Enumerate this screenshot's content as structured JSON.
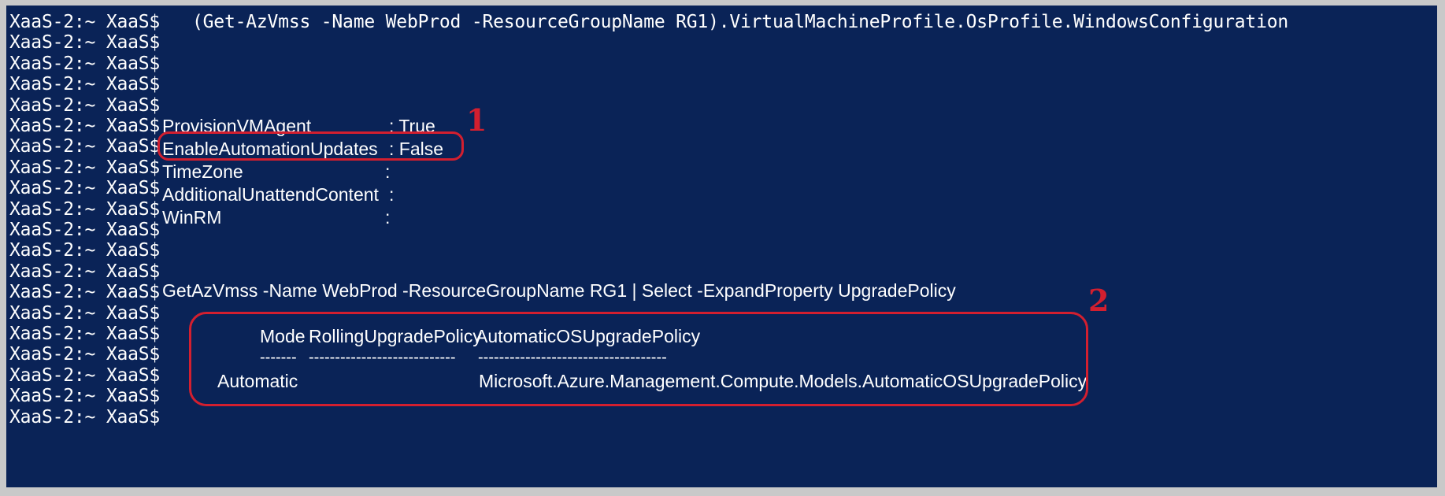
{
  "terminal": {
    "prompt": "XaaS-2:~ XaaS$",
    "command1": "(Get-AzVmss -Name WebProd -ResourceGroupName RG1).VirtualMachineProfile.OsProfile.WindowsConfiguration",
    "properties": [
      {
        "name": "ProvisionVMAgent",
        "value": ": True"
      },
      {
        "name": "EnableAutomationUpdates",
        "value": ": False"
      },
      {
        "name": "TimeZone",
        "value": ":"
      },
      {
        "name": "AdditionalUnattendContent",
        "value": ":"
      },
      {
        "name": "WinRM",
        "value": ":"
      }
    ],
    "command2": "GetAzVmss -Name WebProd -ResourceGroupName RG1 | Select -ExpandProperty UpgradePolicy",
    "table": {
      "headers": [
        "Mode",
        "RollingUpgradePolicy",
        "AutomaticOSUpgradePolicy"
      ],
      "dashes": [
        "-------",
        "----------------------------",
        "------------------------------------"
      ],
      "row": [
        "Automatic",
        "",
        "Microsoft.Azure.Management.Compute.Models.AutomaticOSUpgradePolicy"
      ]
    }
  },
  "annotations": {
    "label1": "1",
    "label2": "2",
    "color": "#d31f2f"
  },
  "colors": {
    "background": "#0a2357",
    "text": "#ffffff",
    "frame": "#c9c9c9"
  }
}
